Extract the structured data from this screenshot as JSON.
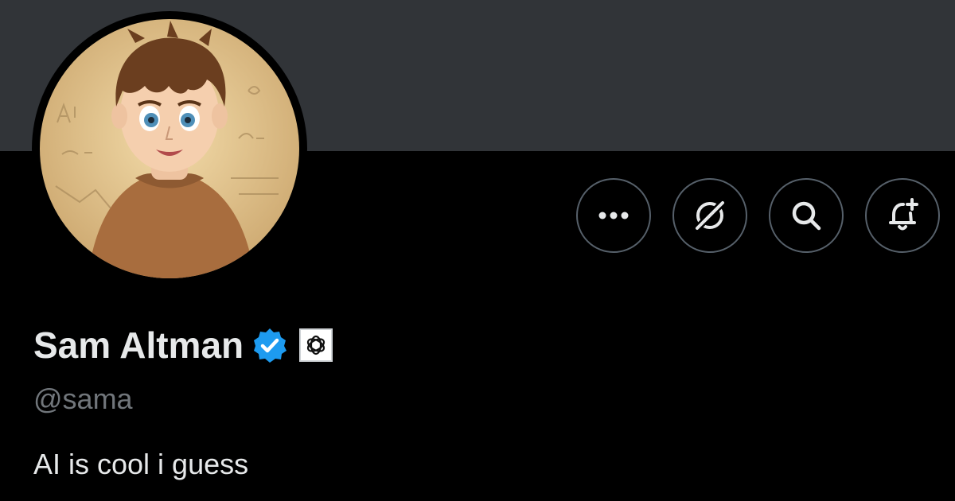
{
  "profile": {
    "display_name": "Sam Altman",
    "handle": "@sama",
    "bio": "AI is cool i guess",
    "verified": true,
    "affiliation_icon": "openai-logo-icon"
  },
  "actions": [
    {
      "name": "more-options-button",
      "icon": "ellipsis-icon"
    },
    {
      "name": "grok-button",
      "icon": "grok-icon"
    },
    {
      "name": "search-button",
      "icon": "search-icon"
    },
    {
      "name": "notifications-button",
      "icon": "bell-plus-icon"
    }
  ],
  "colors": {
    "banner": "#313438",
    "background": "#000000",
    "verified_badge": "#1d9bf0",
    "primary_text": "#e7e9ea",
    "secondary_text": "#71767b",
    "button_border": "#56606a"
  }
}
